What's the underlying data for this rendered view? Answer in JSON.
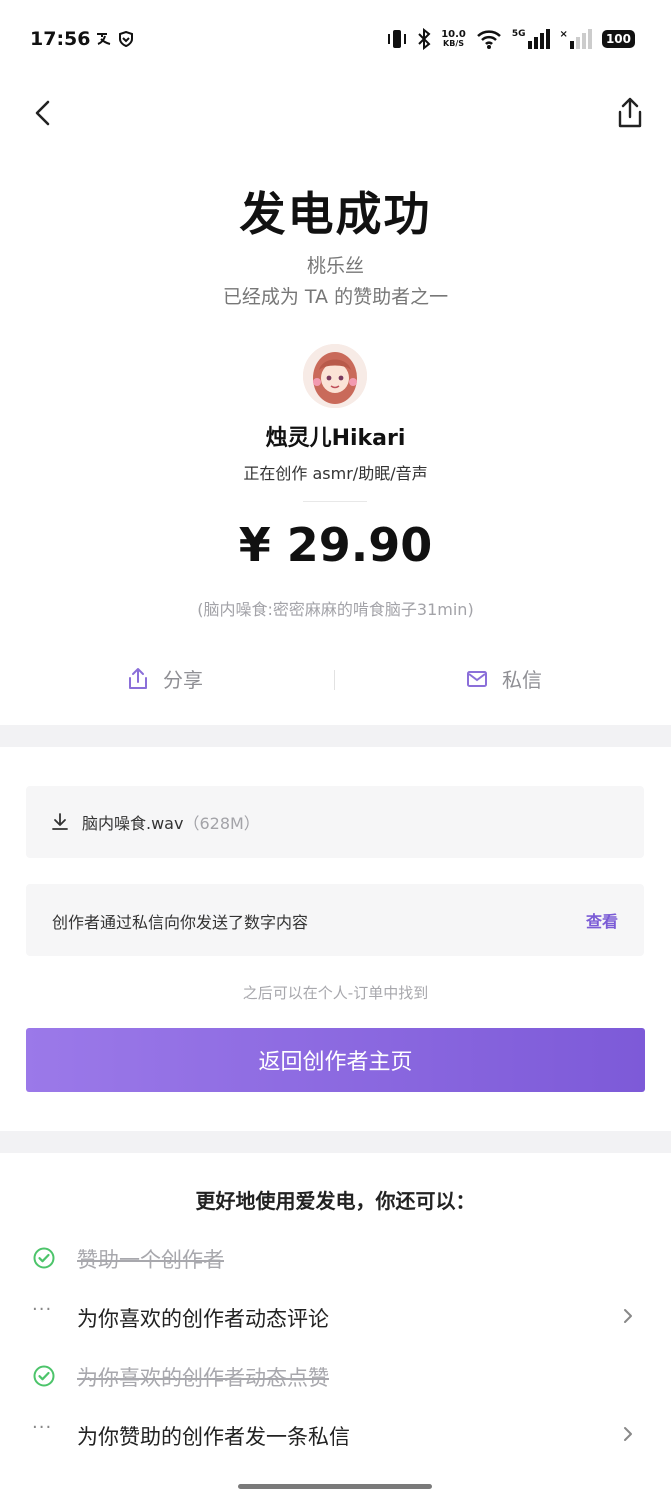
{
  "status_bar": {
    "time": "17:56",
    "left_icons": [
      "notification-icon",
      "shield-icon"
    ],
    "net_speed_value": "10.0",
    "net_speed_unit": "KB/S",
    "network": "5G",
    "battery": "100"
  },
  "header": {
    "title": "发电成功",
    "supporter_name": "桃乐丝",
    "supporter_status": "已经成为 TA 的赞助者之一"
  },
  "creator": {
    "name": "烛灵儿Hikari",
    "description": "正在创作 asmr/助眠/音声"
  },
  "payment": {
    "amount": "¥ 29.90",
    "note": "(脑内噪食:密密麻麻的啃食脑子31min)"
  },
  "actions": {
    "share_label": "分享",
    "message_label": "私信"
  },
  "download": {
    "file_name": "脑内噪食.wav",
    "file_size": "（628M）"
  },
  "digital_content": {
    "text": "创作者通过私信向你发送了数字内容",
    "link_label": "查看"
  },
  "hint": "之后可以在个人-订单中找到",
  "primary_button": "返回创作者主页",
  "more": {
    "title": "更好地使用爱发电，你还可以：",
    "tasks": [
      {
        "label": "赞助一个创作者",
        "done": true
      },
      {
        "label": "为你喜欢的创作者动态评论",
        "done": false
      },
      {
        "label": "为你喜欢的创作者动态点赞",
        "done": true
      },
      {
        "label": "为你赞助的创作者发一条私信",
        "done": false
      }
    ]
  },
  "colors": {
    "accent": "#7d5ad8",
    "success_green": "#4cc46a",
    "muted_text": "#a8a8ad"
  }
}
